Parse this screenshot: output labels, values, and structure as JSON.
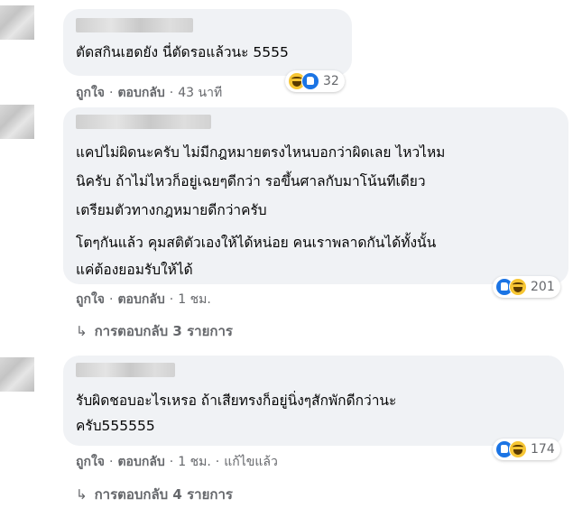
{
  "comments": [
    {
      "text_lines": [
        "ตัดสกินเฮดยัง นี่ตัดรอแล้วนะ 5555"
      ],
      "actions": {
        "like": "ถูกใจ",
        "reply": "ตอบกลับ",
        "time": "43 นาที"
      },
      "reactions": {
        "icons": [
          "haha-icon",
          "like-icon"
        ],
        "count": "32"
      }
    },
    {
      "text_lines": [
        "แคปไม่ผิดนะครับ ไม่มีกฎหมายตรงไหนบอกว่าผิดเลย ไหวไหม",
        "นิครับ ถ้าไม่ไหวก็อยู่เฉยๆดีกว่า รอขึ้นศาลกับมาโน้นทีเดียว",
        "เตรียมตัวทางกฎหมายดีกว่าครับ",
        "โตๆกันแล้ว คุมสติตัวเองให้ได้หน่อย คนเราพลาดกันได้ทั้งนั้น",
        "แค่ต้องยอมรับให้ได้"
      ],
      "actions": {
        "like": "ถูกใจ",
        "reply": "ตอบกลับ",
        "time": "1 ชม."
      },
      "reactions": {
        "icons": [
          "like-icon",
          "haha-icon"
        ],
        "count": "201"
      },
      "view_replies": "การตอบกลับ 3 รายการ"
    },
    {
      "text_lines": [
        "รับผิดชอบอะไรเหรอ ถ้าเสียทรงก็อยู่นิ่งๆสักพักดีกว่านะ",
        "ครับ555555"
      ],
      "actions": {
        "like": "ถูกใจ",
        "reply": "ตอบกลับ",
        "time": "1 ชม.",
        "edited": "แก้ไขแล้ว"
      },
      "reactions": {
        "icons": [
          "like-icon",
          "haha-icon"
        ],
        "count": "174"
      },
      "view_replies": "การตอบกลับ 4 รายการ"
    }
  ],
  "colors": {
    "bubble": "#f0f2f5",
    "meta_text": "#65676b",
    "like_blue": "#1b74e4",
    "haha_yellow": "#f7c634"
  }
}
